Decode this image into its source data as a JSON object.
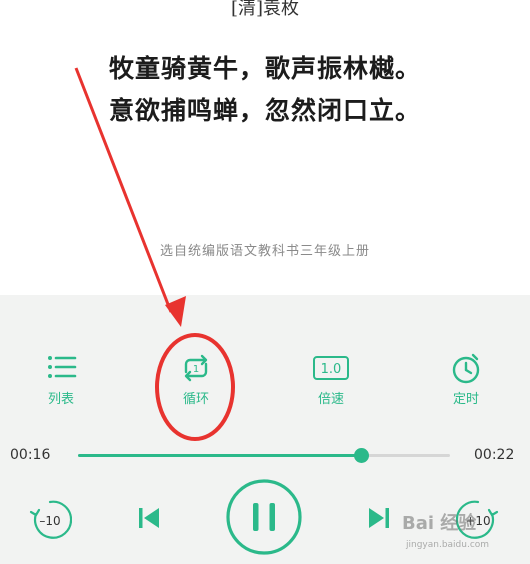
{
  "poem": {
    "author": "[清]袁枚",
    "lines": [
      "牧童骑黄牛，歌声振林樾。",
      "意欲捕鸣蝉，忽然闭口立。"
    ],
    "source": "选自统编版语文教科书三年级上册"
  },
  "controls": {
    "list": {
      "label": "列表",
      "icon": "list-icon"
    },
    "loop": {
      "label": "循环",
      "icon": "repeat-one-icon",
      "badge": "1"
    },
    "speed": {
      "label": "倍速",
      "icon": "speed-icon",
      "value": "1.0"
    },
    "timer": {
      "label": "定时",
      "icon": "timer-icon"
    }
  },
  "progress": {
    "current": "00:16",
    "total": "00:22",
    "fraction": 0.76
  },
  "playback": {
    "skip_back": "–10",
    "skip_forward": "+10",
    "state": "playing"
  },
  "watermark": {
    "brand": "Bai 经验",
    "url": "jingyan.baidu.com"
  },
  "colors": {
    "accent": "#2bb98a",
    "annotation": "#e8332f",
    "panel": "#f2f3f2"
  }
}
